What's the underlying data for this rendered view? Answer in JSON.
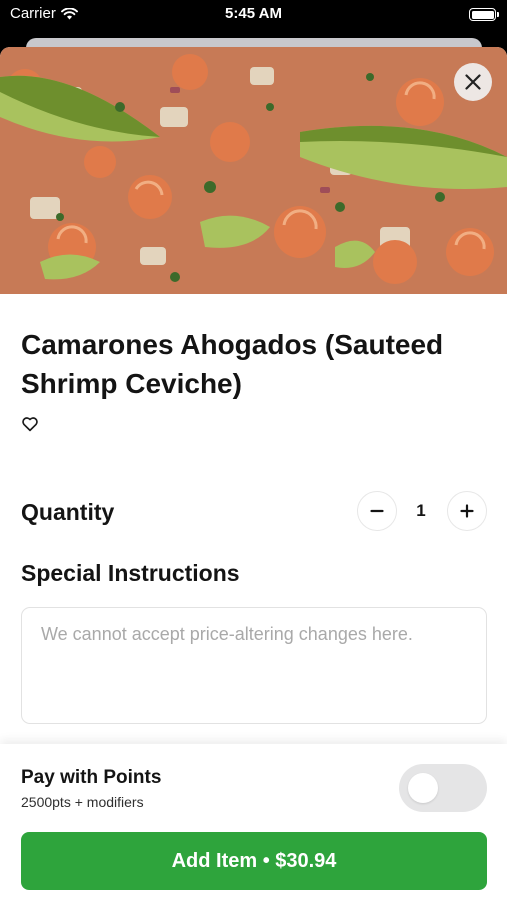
{
  "status_bar": {
    "carrier": "Carrier",
    "time": "5:45 AM",
    "wifi_icon": "wifi-icon",
    "battery_icon": "battery-icon"
  },
  "hero": {
    "image": "shrimp-ceviche-photo",
    "close_icon": "close-icon"
  },
  "item": {
    "title": "Camarones Ahogados (Sauteed Shrimp Ceviche)",
    "favorite_icon": "heart-outline-icon"
  },
  "quantity": {
    "label": "Quantity",
    "value": "1",
    "minus_icon": "minus-icon",
    "plus_icon": "plus-icon"
  },
  "instructions": {
    "label": "Special Instructions",
    "placeholder": "We cannot accept price-altering changes here.",
    "value": ""
  },
  "points": {
    "title": "Pay with Points",
    "subtitle": "2500pts + modifiers",
    "toggle_on": false
  },
  "add_button": {
    "label": "Add Item • $30.94"
  },
  "colors": {
    "accent_green": "#2ea43c",
    "toggle_off": "#e5e5e6",
    "text_primary": "#141414"
  }
}
